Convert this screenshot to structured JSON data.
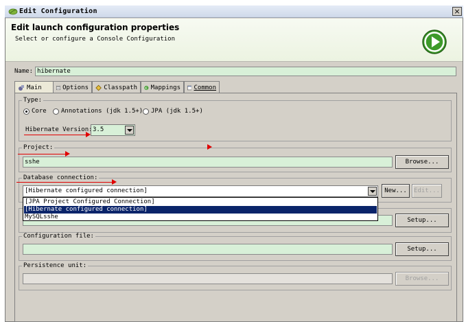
{
  "window": {
    "title": "Edit Configuration",
    "close_label": "×"
  },
  "banner": {
    "title": "Edit launch configuration properties",
    "subtitle": "Select or configure a Console Configuration"
  },
  "name_field": {
    "label": "Name:",
    "value": "hibernate"
  },
  "tabs": [
    {
      "label": "Main"
    },
    {
      "label": "Options"
    },
    {
      "label": "Classpath"
    },
    {
      "label": "Mappings"
    },
    {
      "label": "Common"
    }
  ],
  "type_group": {
    "label": "Type:",
    "options": [
      "Core",
      "Annotations (jdk 1.5+)",
      "JPA (jdk 1.5+)"
    ],
    "selected": "Core",
    "version_label": "Hibernate Version:",
    "version_value": "3.5"
  },
  "project_group": {
    "label": "Project:",
    "value": "sshe",
    "browse_label": "Browse..."
  },
  "db_group": {
    "label": "Database connection:",
    "value": "[Hibernate configured connection]",
    "new_label": "New...",
    "edit_label": "Edit...",
    "options": [
      "[JPA Project Configured Connection]",
      "[Hibernate configured connection]",
      "MySQLsshe"
    ],
    "selected_index": 1
  },
  "property_group": {
    "setup_label": "Setup..."
  },
  "config_group": {
    "label": "Configuration file:",
    "setup_label": "Setup..."
  },
  "persistence_group": {
    "label": "Persistence unit:",
    "browse_label": "Browse..."
  },
  "colors": {
    "accent": "#e00000",
    "selection": "#0a246a",
    "field_bg": "#d8f0d8"
  }
}
